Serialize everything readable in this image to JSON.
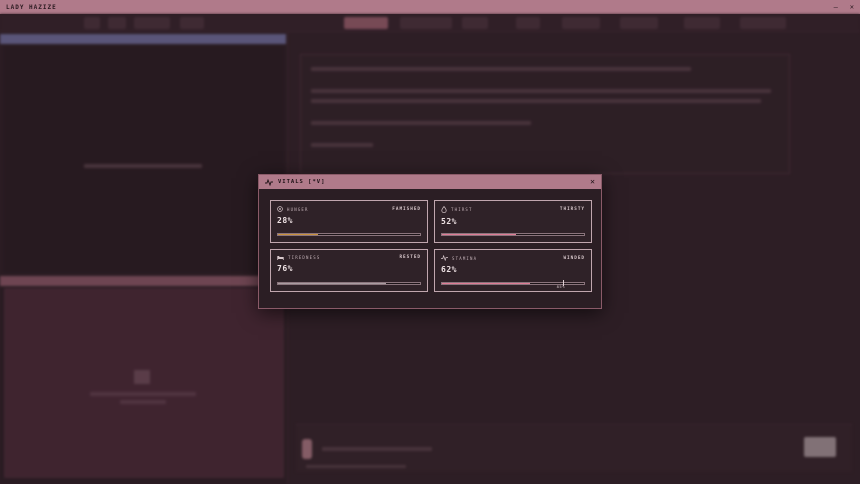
{
  "app": {
    "title": "LADY HAZIZE"
  },
  "window_controls": {
    "minimize": "–",
    "close": "✕"
  },
  "modal": {
    "title": "VITALS [*V]",
    "close_label": "✕",
    "cards": [
      {
        "label": "HUNGER",
        "status": "FAMISHED",
        "value": "28%",
        "fraction": 0.28,
        "color": "#c9923c",
        "icon": "stomach-icon"
      },
      {
        "label": "THIRST",
        "status": "THIRSTY",
        "value": "52%",
        "fraction": 0.52,
        "color": "#e07c96",
        "icon": "droplet-icon"
      },
      {
        "label": "TIREDNESS",
        "status": "RESTED",
        "value": "76%",
        "fraction": 0.76,
        "color": "#a89ca0",
        "icon": "bed-icon"
      },
      {
        "label": "STAMINA",
        "status": "WINDED",
        "value": "62%",
        "fraction": 0.62,
        "color": "#e07c96",
        "icon": "pulse-icon",
        "marker_label": "85%",
        "marker_fraction": 0.85
      }
    ]
  },
  "colors": {
    "accent": "#b07a8a",
    "panel": "#2b1e24",
    "border": "#c0a6ae"
  }
}
